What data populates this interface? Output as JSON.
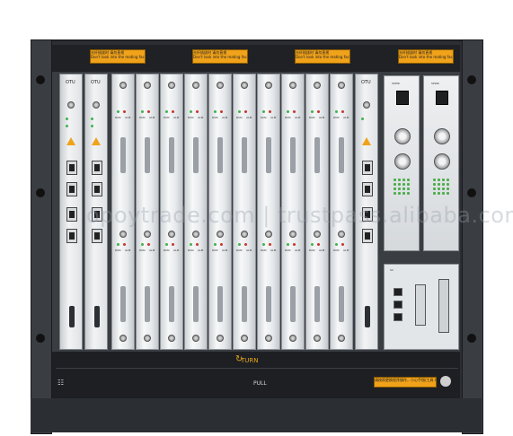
{
  "warning_label_text": "光纤插拔时 请勿直视",
  "warning_label_sub": "Don't look into the mating face",
  "otu_label": "OTU",
  "bottom": {
    "logo_text": "TURN",
    "pull_text": "PULL",
    "warning_bottom": "请按照更换程序操作，小心手指/工具 Caution!"
  },
  "watermark": "opoytrade.com | trustpass.alibaba.com",
  "led_labels": [
    "RUN",
    "ALM"
  ],
  "psu_labels": [
    "SPWR",
    "SPWR"
  ],
  "ctrl_labels": [
    "SC"
  ],
  "colors": {
    "rack": "#2b2e33",
    "warning": "#f0a21a",
    "led_green": "#3fb34a",
    "led_red": "#c8362b"
  }
}
